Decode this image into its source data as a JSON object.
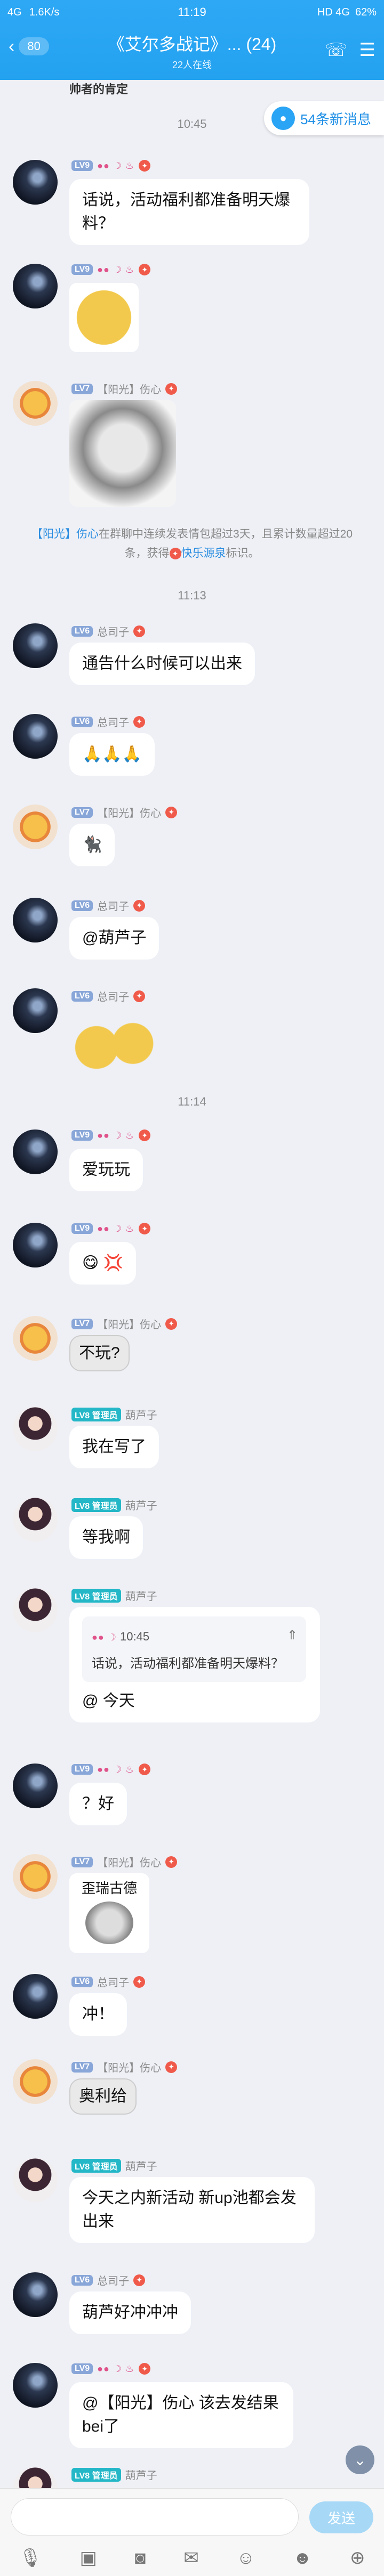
{
  "status": {
    "left": "4G",
    "speed": "1.6K/s",
    "time": "11:19",
    "right": "HD 4G",
    "battery": "62%"
  },
  "header": {
    "back_count": "80",
    "title": "《艾尔多战记》...",
    "count": "(24)",
    "subtitle": "22人在线"
  },
  "truncated_text": "帅者的肯定",
  "new_messages": "54条新消息",
  "messages": [
    {
      "time": "10:45"
    },
    {
      "lv": "LV9",
      "name": "",
      "text": "话说，活动福利都准备明天爆料？"
    },
    {
      "lv": "",
      "name": "",
      "img": "emoji-face"
    },
    {
      "lv": "LV7",
      "name": "【阳光】伤心",
      "img": "panda-meme"
    },
    {
      "notice_a": "【阳光】伤心",
      "notice_b": "在群聊中连续发表情包超过3天，且累计数量超过20条，获得",
      "notice_c": "快乐源泉",
      "notice_d": "标识。"
    },
    {
      "time": "11:13"
    },
    {
      "lv": "LV6",
      "name": "总司子",
      "text": "通告什么时候可以出来"
    },
    {
      "lv": "LV6",
      "name": "总司子",
      "img": "pray"
    },
    {
      "lv": "LV7",
      "name": "【阳光】伤心",
      "img": "cat"
    },
    {
      "lv": "LV6",
      "name": "总司子",
      "text": "@葫芦子"
    },
    {
      "lv": "LV6",
      "name": "总司子",
      "img": "bear-sticker"
    },
    {
      "time": "11:14"
    },
    {
      "lv": "LV9",
      "name": "",
      "text": "爱玩玩"
    },
    {
      "lv": "LV9",
      "name": "",
      "text": "😋 💢"
    },
    {
      "lv": "LV7",
      "name": "【阳光】伤心",
      "text": "不玩?"
    },
    {
      "lv": "LV8",
      "admin": "管理员",
      "name": "葫芦子",
      "text": "我在写了"
    },
    {
      "lv": "LV8",
      "admin": "管理员",
      "name": "葫芦子",
      "text": "等我啊"
    },
    {
      "lv": "LV8",
      "admin": "管理员",
      "name": "葫芦子",
      "quote_time": "10:45",
      "quote_text": "话说，活动福利都准备明天爆料？",
      "text": "@ 今天"
    },
    {
      "lv": "LV9",
      "name": "",
      "text": "？好"
    },
    {
      "lv": "LV7",
      "name": "【阳光】伤心",
      "text": "歪瑞古德"
    },
    {
      "lv": "LV6",
      "name": "总司子",
      "text": "冲！"
    },
    {
      "lv": "LV7",
      "name": "【阳光】伤心",
      "text": "奥利给"
    },
    {
      "lv": "LV8",
      "admin": "管理员",
      "name": "葫芦子",
      "text": "今天之内新活动 新up池都会发出来"
    },
    {
      "lv": "LV6",
      "name": "总司子",
      "text": "葫芦好冲冲冲"
    },
    {
      "lv": "LV9",
      "name": "",
      "text": "@【阳光】伤心 该去发结果bei了"
    },
    {
      "lv": "LV8",
      "admin": "管理员",
      "name": "葫芦子"
    }
  ],
  "input": {
    "placeholder": "",
    "send": "发送"
  },
  "colors": {
    "brand": "#23a2f0",
    "bg": "#eef0f6"
  }
}
